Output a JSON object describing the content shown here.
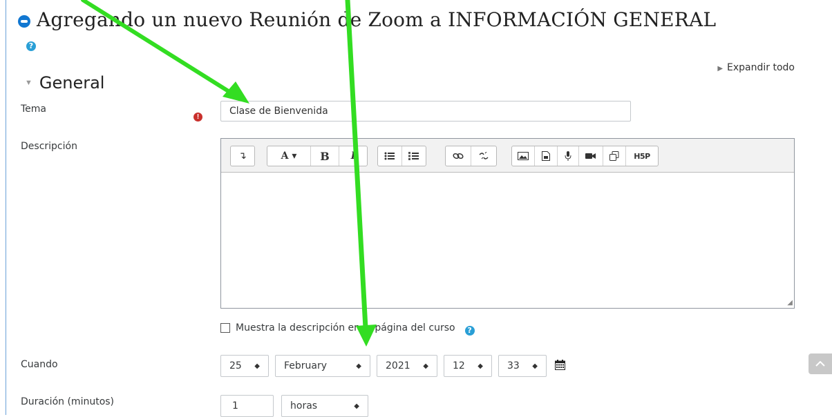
{
  "page": {
    "title": "Agregando un nuevo Reunión de Zoom a INFORMACIÓN GENERAL",
    "help": "?",
    "expand_all": "Expandir todo"
  },
  "section": {
    "title": "General"
  },
  "form": {
    "tema": {
      "label": "Tema",
      "value": "Clase de Bienvenida",
      "required_mark": "!"
    },
    "descripcion": {
      "label": "Descripción",
      "toolbar_icons": [
        "collapse-icon",
        "text-format-icon",
        "bold-icon",
        "italic-icon",
        "bullet-list-icon",
        "numbered-list-icon",
        "link-icon",
        "unlink-icon",
        "image-icon",
        "media-icon",
        "microphone-icon",
        "video-icon",
        "manage-files-icon",
        "h5p-icon"
      ],
      "toolbar_labels": {
        "collapse": "↴",
        "font": "A ▾",
        "bold": "B",
        "italic": "I",
        "h5p": "H5P"
      }
    },
    "show_description": {
      "label": "Muestra la descripción en la página del curso",
      "checked": false
    },
    "cuando": {
      "label": "Cuando",
      "day": "25",
      "month": "February",
      "year": "2021",
      "hour": "12",
      "minute": "33"
    },
    "duracion": {
      "label": "Duración (minutos)",
      "value": "1",
      "unit": "horas"
    }
  },
  "colors": {
    "annotation_arrow": "#33dd22",
    "accent": "#1177d1",
    "required": "#c9302c"
  }
}
